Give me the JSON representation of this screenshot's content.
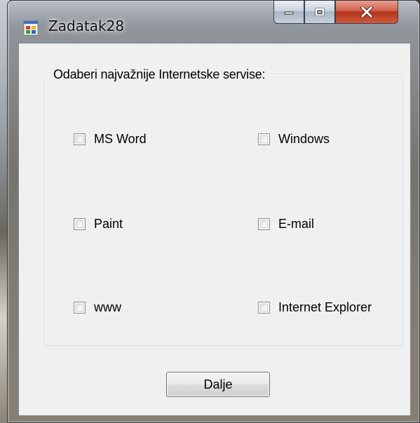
{
  "window": {
    "title": "Zadatak28",
    "controls": {
      "minimize": "minimize-icon",
      "maximize": "maximize-icon",
      "close": "close-icon"
    }
  },
  "group": {
    "legend": "Odaberi najvažnije Internetske servise:"
  },
  "checkboxes": [
    {
      "label": "MS Word",
      "checked": false
    },
    {
      "label": "Windows",
      "checked": false
    },
    {
      "label": "Paint",
      "checked": false
    },
    {
      "label": "E-mail",
      "checked": false
    },
    {
      "label": "www",
      "checked": false
    },
    {
      "label": "Internet Explorer",
      "checked": false
    }
  ],
  "button": {
    "label": "Dalje"
  },
  "colors": {
    "client_bg": "#f0f0f0",
    "close_red": "#c7432a",
    "frame_border": "#2f3236"
  }
}
